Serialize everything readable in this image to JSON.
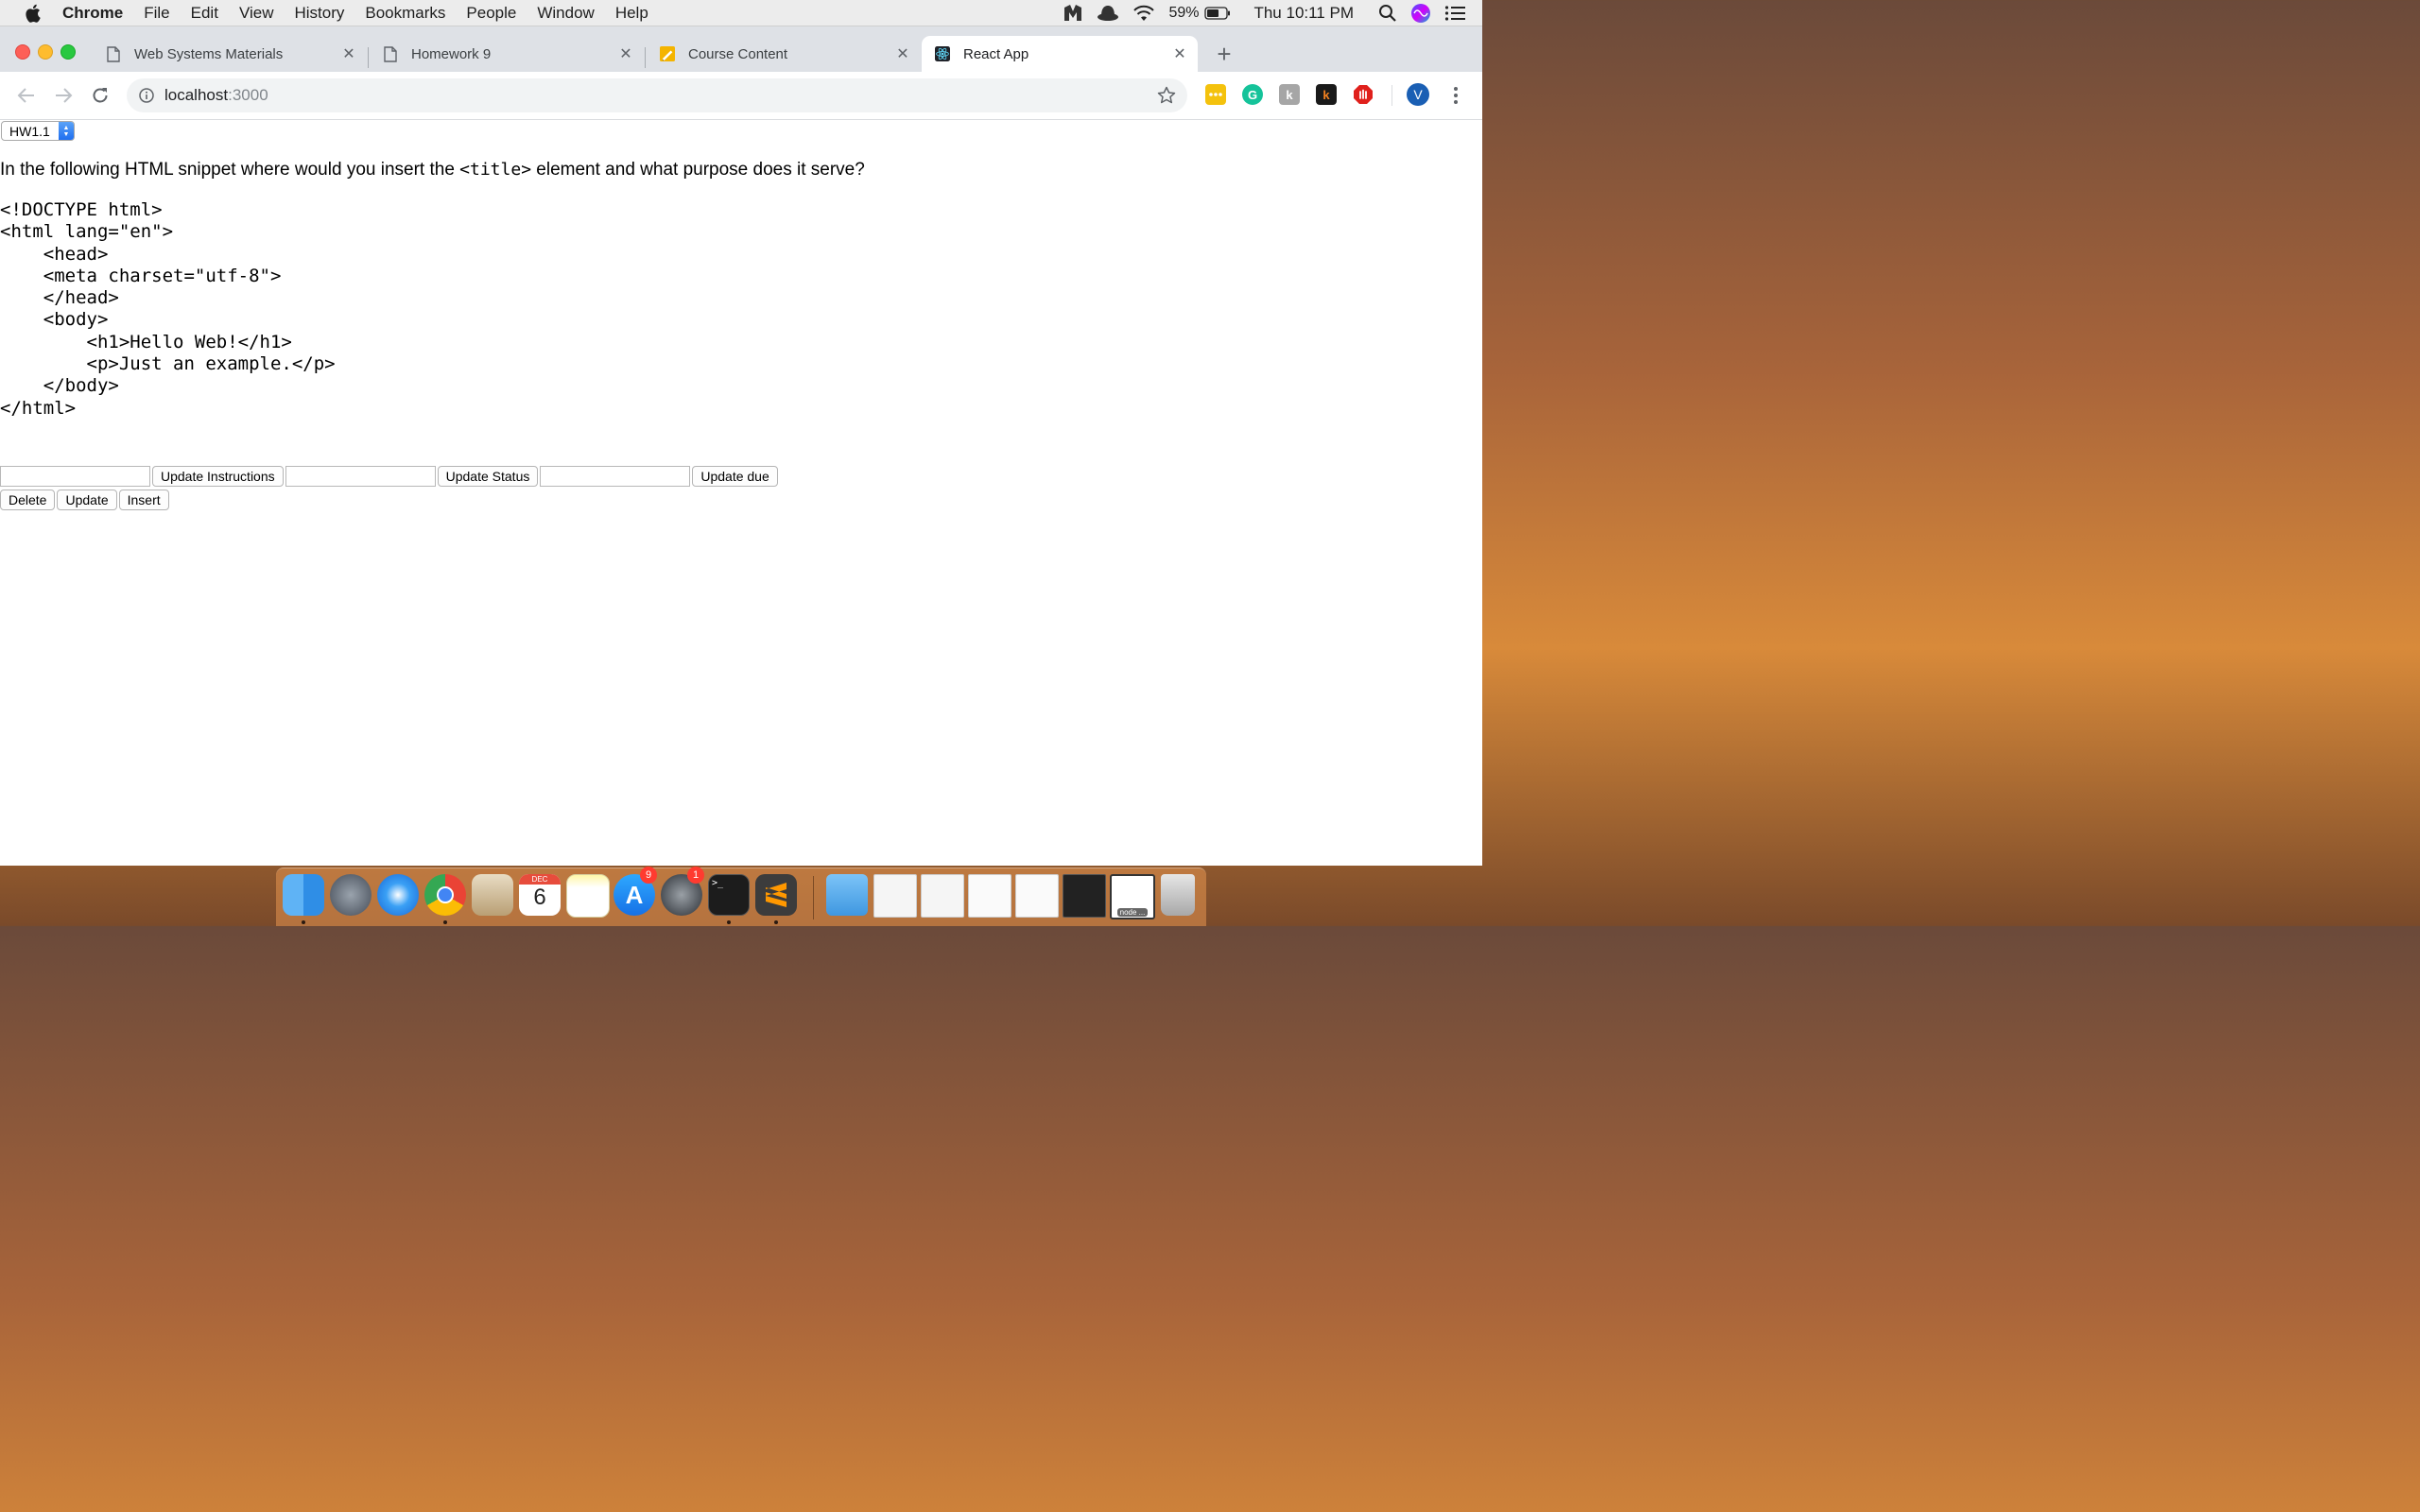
{
  "menubar": {
    "app_name": "Chrome",
    "items": [
      "File",
      "Edit",
      "View",
      "History",
      "Bookmarks",
      "People",
      "Window",
      "Help"
    ],
    "battery": "59%",
    "clock": "Thu 10:11 PM"
  },
  "tabs": [
    {
      "title": "Web Systems Materials",
      "icon": "document-icon",
      "active": false
    },
    {
      "title": "Homework 9",
      "icon": "document-icon",
      "active": false
    },
    {
      "title": "Course Content",
      "icon": "pencil-ruler-icon",
      "active": false
    },
    {
      "title": "React App",
      "icon": "react-icon",
      "active": true
    }
  ],
  "address_bar": {
    "host": "localhost",
    "port": ":3000"
  },
  "profile_initial": "V",
  "page": {
    "select_value": "HW1.1",
    "question_prefix": "In the following HTML snippet where would you insert the ",
    "question_code": "<title>",
    "question_suffix": " element and what purpose does it serve?",
    "snippet": "<!DOCTYPE html>\n<html lang=\"en\">\n    <head>\n    <meta charset=\"utf-8\">\n    </head>\n    <body>\n        <h1>Hello Web!</h1>\n        <p>Just an example.</p>\n    </body>\n</html>",
    "inputs": {
      "instructions_value": "",
      "status_value": "",
      "due_value": ""
    },
    "buttons": {
      "update_instructions": "Update Instructions",
      "update_status": "Update Status",
      "update_due": "Update due",
      "delete": "Delete",
      "update": "Update",
      "insert": "Insert"
    }
  },
  "dock": {
    "appstore_badge": "9",
    "settings_badge": "1",
    "calendar_month": "DEC",
    "calendar_day": "6",
    "node_label": "node ..."
  }
}
